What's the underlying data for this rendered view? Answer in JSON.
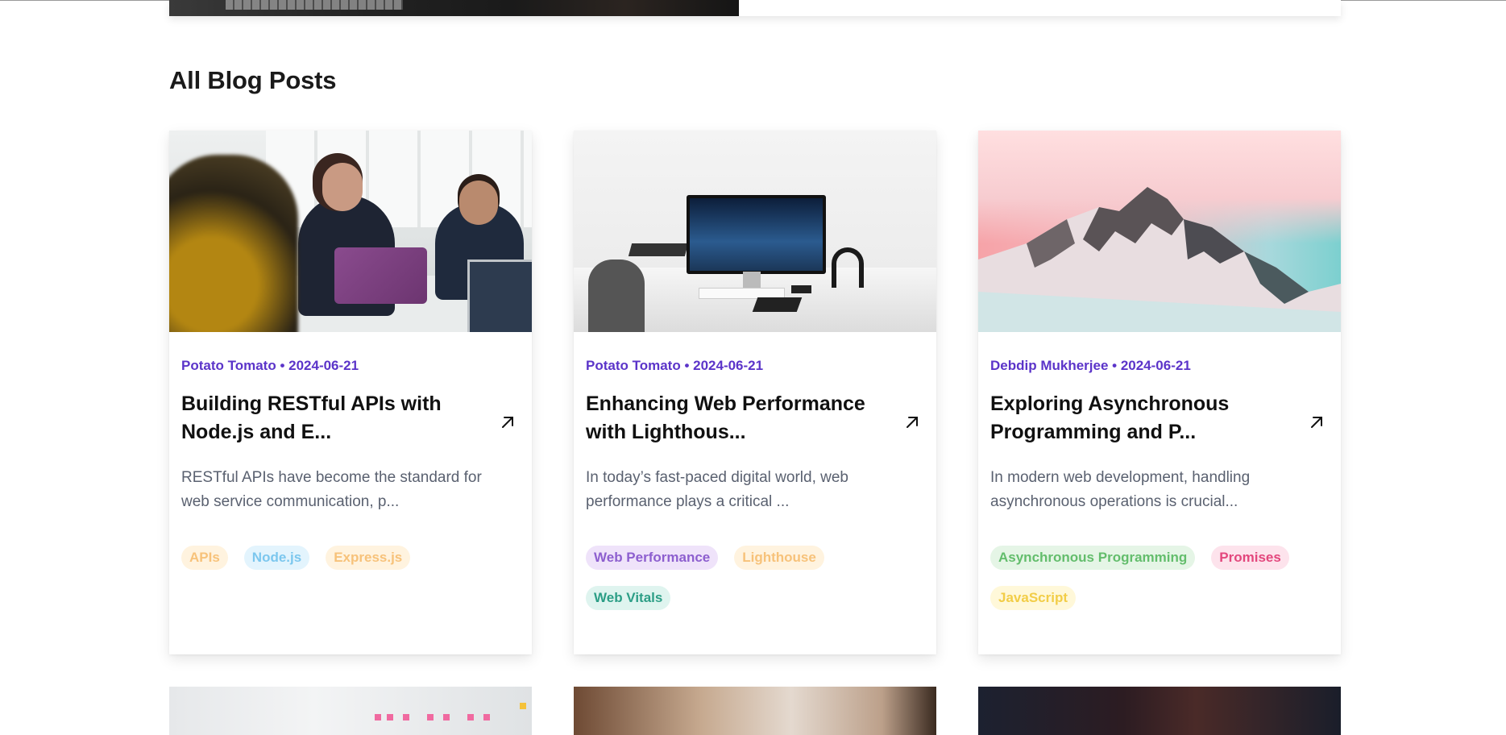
{
  "section": {
    "title": "All Blog Posts"
  },
  "posts": [
    {
      "author": "Potato Tomato",
      "date": "2024-06-21",
      "meta": "Potato Tomato • 2024-06-21",
      "title": "Building RESTful APIs with Node.js and E...",
      "excerpt": "RESTful APIs have become the standard for web service communication, p...",
      "image": "office-team-photo",
      "tags": [
        {
          "label": "APIs",
          "bg": "#fff3df",
          "fg": "#f7c27a"
        },
        {
          "label": "Node.js",
          "bg": "#e3f4fd",
          "fg": "#7cc7ee"
        },
        {
          "label": "Express.js",
          "bg": "#fff3df",
          "fg": "#f7c27a"
        }
      ]
    },
    {
      "author": "Potato Tomato",
      "date": "2024-06-21",
      "meta": "Potato Tomato • 2024-06-21",
      "title": "Enhancing Web Performance with Lighthous...",
      "excerpt": "In today’s fast-paced digital world, web performance plays a critical ...",
      "image": "desk-workspace-photo",
      "tags": [
        {
          "label": "Web Performance",
          "bg": "#efe3fa",
          "fg": "#8d5fcf"
        },
        {
          "label": "Lighthouse",
          "bg": "#fff3df",
          "fg": "#f7c27a"
        },
        {
          "label": "Web Vitals",
          "bg": "#dff4ef",
          "fg": "#2c9e86"
        }
      ]
    },
    {
      "author": "Debdip Mukherjee",
      "date": "2024-06-21",
      "meta": "Debdip Mukherjee • 2024-06-21",
      "title": "Exploring Asynchronous Programming and P...",
      "excerpt": "In modern web development, handling asynchronous operations is crucial...",
      "image": "snowy-mountain-photo",
      "tags": [
        {
          "label": "Asynchronous Programming",
          "bg": "#e5f5e6",
          "fg": "#63bd6c"
        },
        {
          "label": "Promises",
          "bg": "#fde3ec",
          "fg": "#e3477d"
        },
        {
          "label": "JavaScript",
          "bg": "#fff8d9",
          "fg": "#f2cd47"
        }
      ]
    }
  ],
  "icons": {
    "arrow": "arrow-up-right-icon"
  },
  "colors": {
    "meta": "#5b34c9",
    "title": "#101010",
    "excerpt": "#5a6170"
  }
}
